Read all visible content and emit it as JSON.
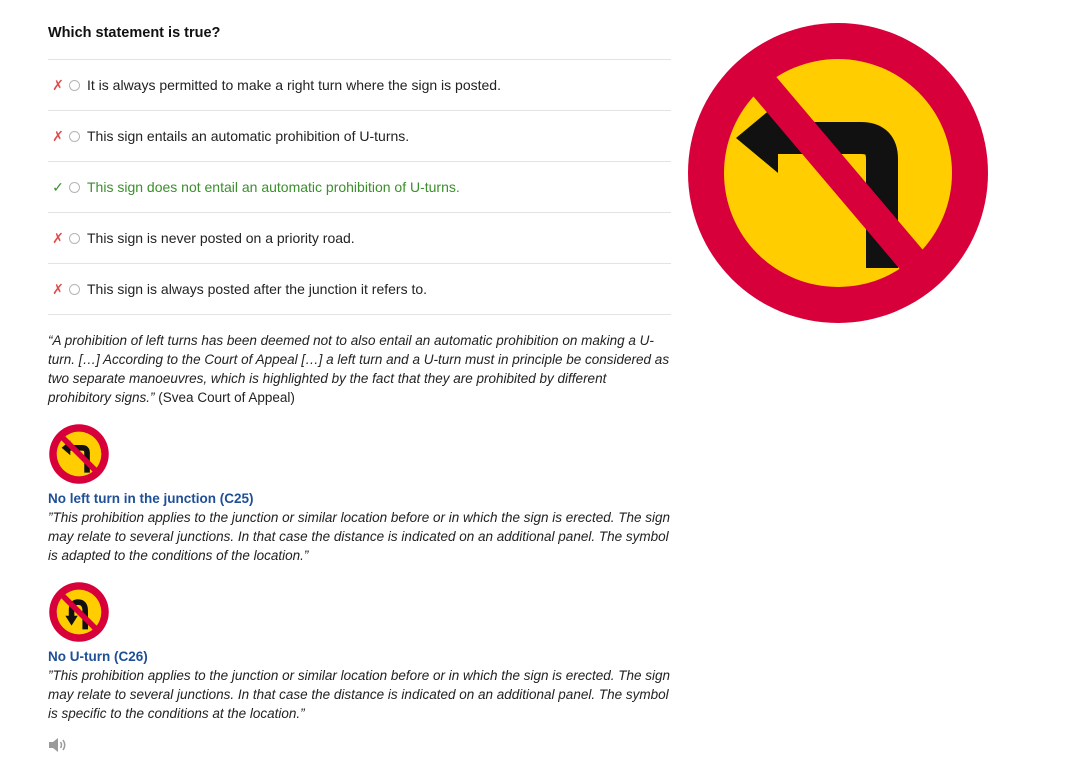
{
  "question": {
    "title": "Which statement is true?"
  },
  "options": [
    {
      "mark": "✗",
      "status": "wrong",
      "text": "It is always permitted to make a right turn where the sign is posted."
    },
    {
      "mark": "✗",
      "status": "wrong",
      "text": "This sign entails an automatic prohibition of U-turns."
    },
    {
      "mark": "✓",
      "status": "correct",
      "text": "This sign does not entail an automatic prohibition of U-turns."
    },
    {
      "mark": "✗",
      "status": "wrong",
      "text": "This sign is never posted on a priority road."
    },
    {
      "mark": "✗",
      "status": "wrong",
      "text": "This sign is always posted after the junction it refers to."
    }
  ],
  "explanation": {
    "quote": "“A prohibition of left turns has been deemed not to also entail an automatic prohibition on making a U-turn. […] According to the Court of Appeal […] a left turn and a U-turn must in principle be considered as two separate manoeuvres, which is highlighted by the fact that they are prohibited by different prohibitory signs.”",
    "source": " (Svea Court of Appeal)"
  },
  "signs": [
    {
      "title": "No left turn in the junction (C25)",
      "icon": "no-left-turn-sign-icon",
      "description": "”This prohibition applies to the junction or similar location before or in which the sign is erected. The sign may relate to several junctions. In that case the distance is indicated on an additional panel. The symbol is adapted to the conditions of the location.”"
    },
    {
      "title": "No U-turn (C26)",
      "icon": "no-u-turn-sign-icon",
      "description": "”This prohibition applies to the junction or similar location before or in which the sign is erected. The sign may relate to several junctions. In that case the distance is indicated on an additional panel. The symbol is specific to the conditions at the location.”"
    }
  ],
  "colors": {
    "sign_red": "#d7003a",
    "sign_yellow": "#ffcd00",
    "correct_green": "#3b8f2d",
    "wrong_red": "#e04b4b",
    "link_blue": "#1f4f97"
  },
  "icons": {
    "main_sign": "no-left-turn-sign-icon",
    "audio": "speaker-icon"
  }
}
